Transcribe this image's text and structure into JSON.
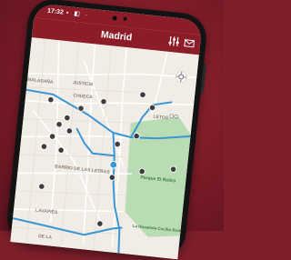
{
  "status_bar": {
    "time": "17:32",
    "icons": "▪ ◧ ·"
  },
  "app_bar": {
    "title": "Madrid"
  },
  "map": {
    "labels": [
      "MALASAÑA",
      "JUSTICIA",
      "CHUECA",
      "BARRIO DE LAS LETRAS",
      "LAVAPIÉS",
      "Parque El Retiro",
      "La Rosaleda Cecilio Rodrigue",
      "LETOS",
      "DE LA"
    ],
    "locate_icon": "crosshair-icon",
    "colors": {
      "brand": "#8c1c28",
      "route": "#3a97d4",
      "marker": "#3d3d3d",
      "park": "#b9dcb4"
    }
  }
}
